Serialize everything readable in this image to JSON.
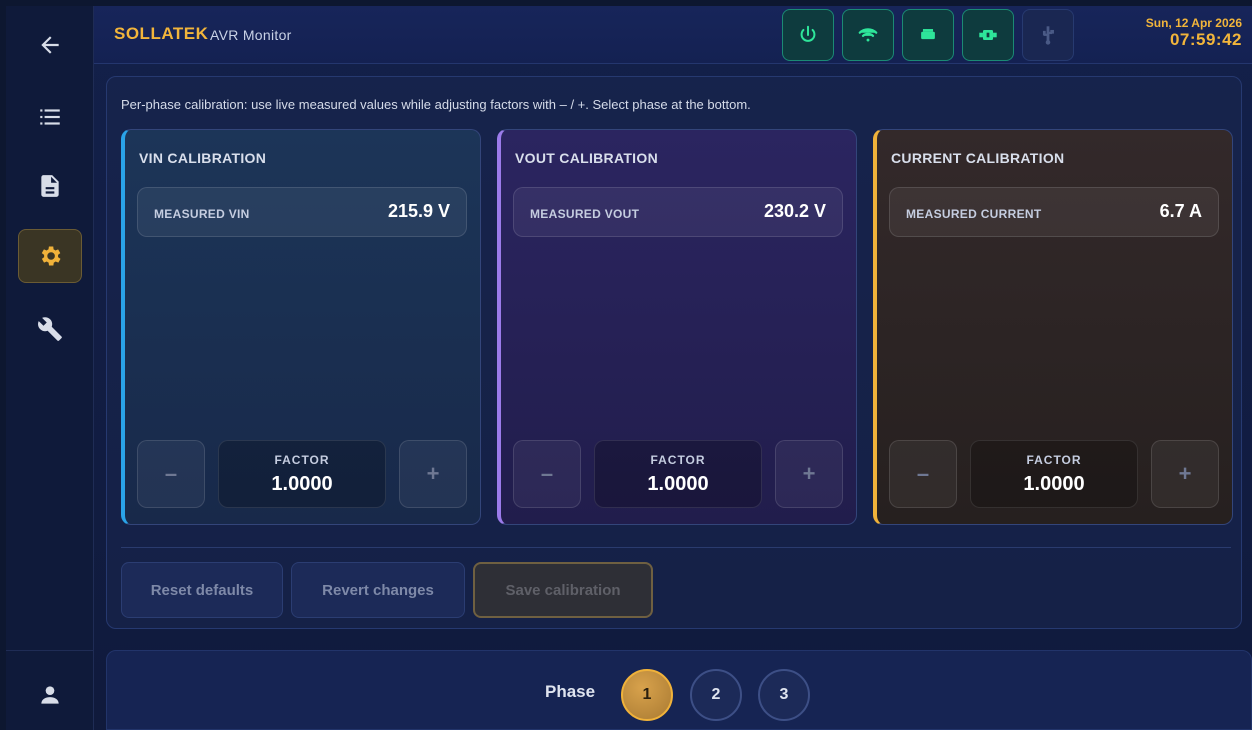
{
  "header": {
    "brand": "SOLLATEK",
    "subtitle": "AVR Monitor",
    "date": "Sun, 12 Apr 2026",
    "time": "07:59:42",
    "status_icons": [
      "power-icon",
      "wifi-icon",
      "battery-icon",
      "relay-icon",
      "usb-icon"
    ]
  },
  "sidebar": {
    "items": [
      "back-icon",
      "list-icon",
      "document-icon",
      "settings-icon",
      "wrench-icon"
    ],
    "active": "settings-icon",
    "footer": "user-icon"
  },
  "main": {
    "hint": "Per-phase calibration: use live measured values while adjusting factors with – / +. Select phase at the bottom.",
    "cards": [
      {
        "title": "VIN CALIBRATION",
        "measure_label": "MEASURED VIN",
        "measure_value": "215.9 V",
        "factor_label": "FACTOR",
        "factor_value": "1.0000"
      },
      {
        "title": "VOUT CALIBRATION",
        "measure_label": "MEASURED VOUT",
        "measure_value": "230.2 V",
        "factor_label": "FACTOR",
        "factor_value": "1.0000"
      },
      {
        "title": "CURRENT CALIBRATION",
        "measure_label": "MEASURED CURRENT",
        "measure_value": "6.7 A",
        "factor_label": "FACTOR",
        "factor_value": "1.0000"
      }
    ],
    "buttons": {
      "reset": "Reset defaults",
      "revert": "Revert changes",
      "save": "Save calibration"
    }
  },
  "footer": {
    "phase_label": "Phase",
    "phases": [
      "1",
      "2",
      "3"
    ],
    "selected_phase": "1"
  },
  "colors": {
    "accent": "#f0b23a",
    "vin": "#2aa3e8",
    "vout": "#9b7bea",
    "current": "#f0b23a",
    "status_ok": "#2ee59a"
  }
}
